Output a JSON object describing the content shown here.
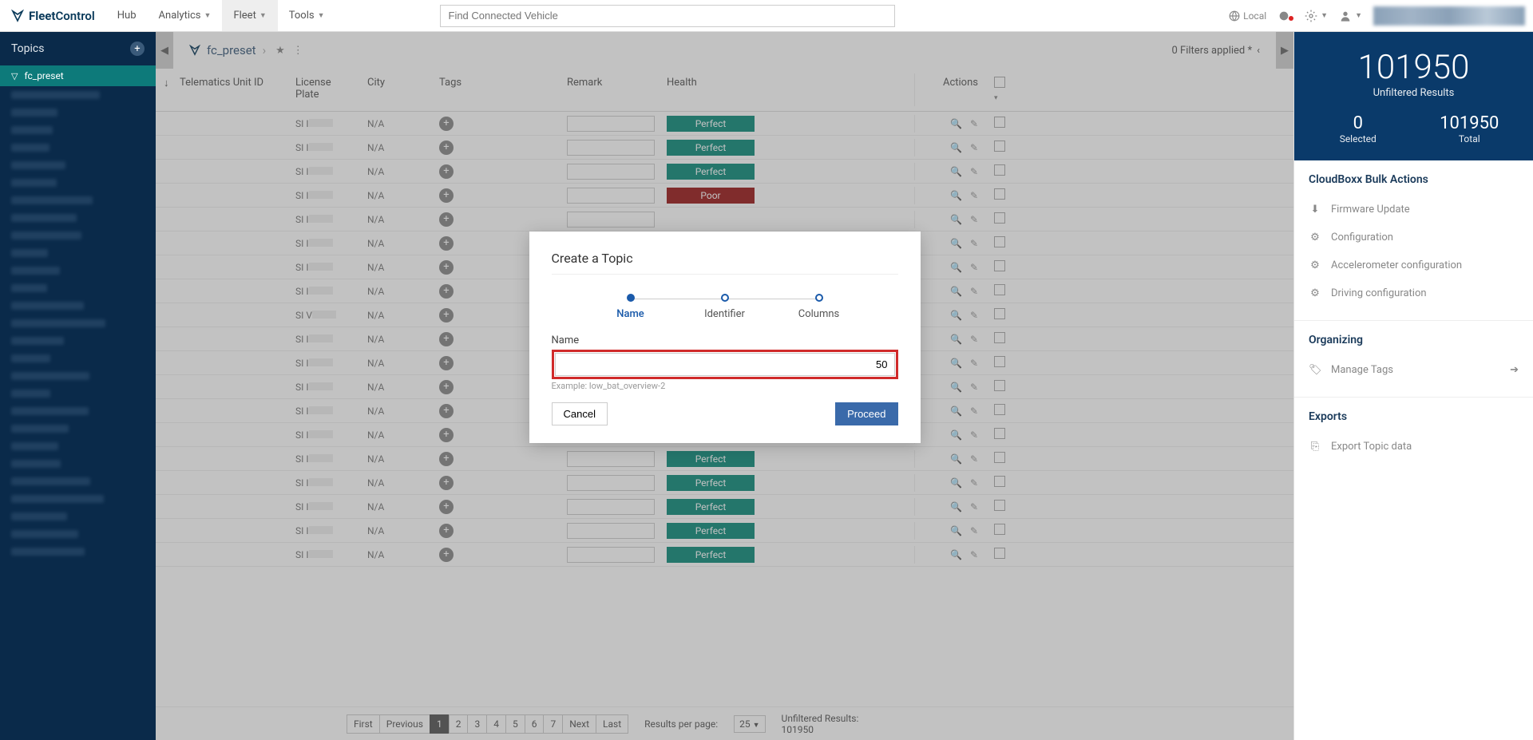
{
  "brand": {
    "a": "Fleet",
    "b": "Control"
  },
  "nav": {
    "hub": "Hub",
    "analytics": "Analytics",
    "fleet": "Fleet",
    "tools": "Tools"
  },
  "search": {
    "placeholder": "Find Connected Vehicle"
  },
  "topright": {
    "local": "Local"
  },
  "sidebar": {
    "title": "Topics",
    "items": [
      {
        "label": "fc_preset",
        "active": true
      }
    ],
    "blurred_item_count": 27
  },
  "header": {
    "title": "fc_preset",
    "filters": "0 Filters applied *"
  },
  "columns": {
    "id": "Telematics Unit ID",
    "plate": "License Plate",
    "city": "City",
    "tags": "Tags",
    "remark": "Remark",
    "health": "Health",
    "actions": "Actions"
  },
  "cell": {
    "na": "N/A",
    "plate_prefix": "SI I",
    "plate_prefix_alt": "SI V"
  },
  "health": {
    "perfect": "Perfect",
    "poor": "Poor"
  },
  "rows": [
    {
      "h": "perfect"
    },
    {
      "h": "perfect"
    },
    {
      "h": "perfect"
    },
    {
      "h": "poor"
    },
    {
      "h": ""
    },
    {
      "h": ""
    },
    {
      "h": ""
    },
    {
      "h": ""
    },
    {
      "h": "",
      "alt": true
    },
    {
      "h": ""
    },
    {
      "h": ""
    },
    {
      "h": ""
    },
    {
      "h": ""
    },
    {
      "h": "perfect"
    },
    {
      "h": "perfect"
    },
    {
      "h": "perfect"
    },
    {
      "h": "perfect"
    },
    {
      "h": "perfect"
    },
    {
      "h": "perfect"
    }
  ],
  "pager": {
    "first": "First",
    "prev": "Previous",
    "next": "Next",
    "last": "Last",
    "pages": [
      "1",
      "2",
      "3",
      "4",
      "5",
      "6",
      "7"
    ],
    "active": "1",
    "results_per_page_label": "Results per page:",
    "results_per_page_value": "25",
    "unfiltered_label": "Unfiltered Results:",
    "unfiltered_value": "101950"
  },
  "right": {
    "big": "101950",
    "big_label": "Unfiltered Results",
    "selected_n": "0",
    "selected_l": "Selected",
    "total_n": "101950",
    "total_l": "Total",
    "bulk_title": "CloudBoxx Bulk Actions",
    "bulk": {
      "firmware": "Firmware Update",
      "config": "Configuration",
      "accel": "Accelerometer configuration",
      "driving": "Driving configuration"
    },
    "org_title": "Organizing",
    "manage_tags": "Manage Tags",
    "exports_title": "Exports",
    "export_topic": "Export Topic data"
  },
  "modal": {
    "title": "Create a Topic",
    "steps": {
      "name": "Name",
      "identifier": "Identifier",
      "columns": "Columns"
    },
    "field_label": "Name",
    "field_value": "50",
    "hint": "Example: low_bat_overview-2",
    "cancel": "Cancel",
    "proceed": "Proceed"
  }
}
